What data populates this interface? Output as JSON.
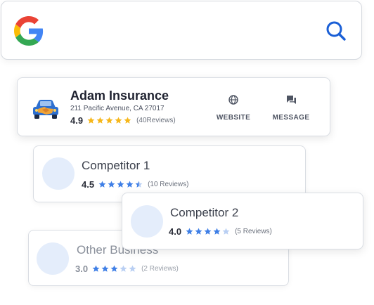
{
  "search": {
    "logo_icon": "google-g-logo-icon",
    "search_icon": "magnifier-icon",
    "accent": "#1a5fd6"
  },
  "business": {
    "name": "Adam Insurance",
    "address": "211 Pacific Avenue, CA 27017",
    "rating": "4.9",
    "rating_value": 4.9,
    "reviews": "(40Reviews)",
    "star_color": "#f6b71a",
    "actions": [
      {
        "label": "WEBSITE",
        "icon": "globe-icon"
      },
      {
        "label": "MESSAGE",
        "icon": "chat-icon"
      }
    ]
  },
  "competitors": [
    {
      "name": "Competitor 1",
      "rating": "4.5",
      "rating_value": 4.5,
      "reviews": "(10 Reviews)"
    },
    {
      "name": "Competitor 2",
      "rating": "4.0",
      "rating_value": 4.0,
      "reviews": "(5 Reviews)"
    },
    {
      "name": "Other Business",
      "rating": "3.0",
      "rating_value": 3.0,
      "reviews": "(2 Reviews)"
    }
  ],
  "colors": {
    "blue_star": "#3f7fe6",
    "empty_star": "#b9cff3"
  }
}
